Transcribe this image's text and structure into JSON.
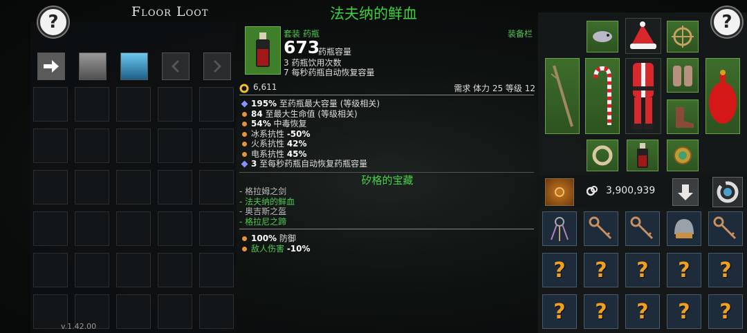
{
  "floor_loot": {
    "title": "Floor Loot",
    "version": "v.1.42.00",
    "help_label": "?"
  },
  "tooltip": {
    "item_name": "法夫纳的鲜血",
    "category": "套装 药瓶",
    "equip_label": "装备栏",
    "capacity_value": "673",
    "capacity_label": "药瓶容量",
    "line_uses": "3 药瓶饮用次数",
    "line_regen": "7 每秒药瓶自动恢复容量",
    "gold": "6,611",
    "requirements": "需求 体力 25 等级 12",
    "stats": [
      {
        "marker": "diamond",
        "value": "195%",
        "text": " 至药瓶最大容量 (等级相关)"
      },
      {
        "marker": "dot",
        "value": "84",
        "text": " 至最大生命值 (等级相关)"
      },
      {
        "marker": "dot",
        "value": "54%",
        "text": " 中毒恢复"
      },
      {
        "marker": "dot",
        "value": "-50%",
        "text": "冰系抗性 "
      },
      {
        "marker": "dot",
        "value": "42%",
        "text": "火系抗性 "
      },
      {
        "marker": "dot",
        "value": "45%",
        "text": "电系抗性 "
      },
      {
        "marker": "diamond",
        "value": "3",
        "text": " 至每秒药瓶自动恢复药瓶容量"
      }
    ],
    "set_name": "矽格的宝藏",
    "set_items": [
      {
        "text": "- 格拉姆之剑",
        "color": "#bbbbbb"
      },
      {
        "text": "- 法夫纳的鲜血",
        "color": "#4ec94e"
      },
      {
        "text": "- 奥吉斯之盔",
        "color": "#bbbbbb"
      },
      {
        "text": "- 格拉尼之蹄",
        "color": "#4ec94e"
      }
    ],
    "set_bonuses": [
      {
        "value": "100%",
        "text": " 防御",
        "color": "#dddddd"
      },
      {
        "value": "-10%",
        "text": "敌人伤害 ",
        "color": "#4ec94e"
      }
    ]
  },
  "inventory": {
    "help_label": "?",
    "gold": "3,900,939",
    "question_mark": "?"
  },
  "colors": {
    "set_green": "#3dd13d",
    "rarity_orange": "#e8923a",
    "magic_blue": "#8a90ff"
  }
}
